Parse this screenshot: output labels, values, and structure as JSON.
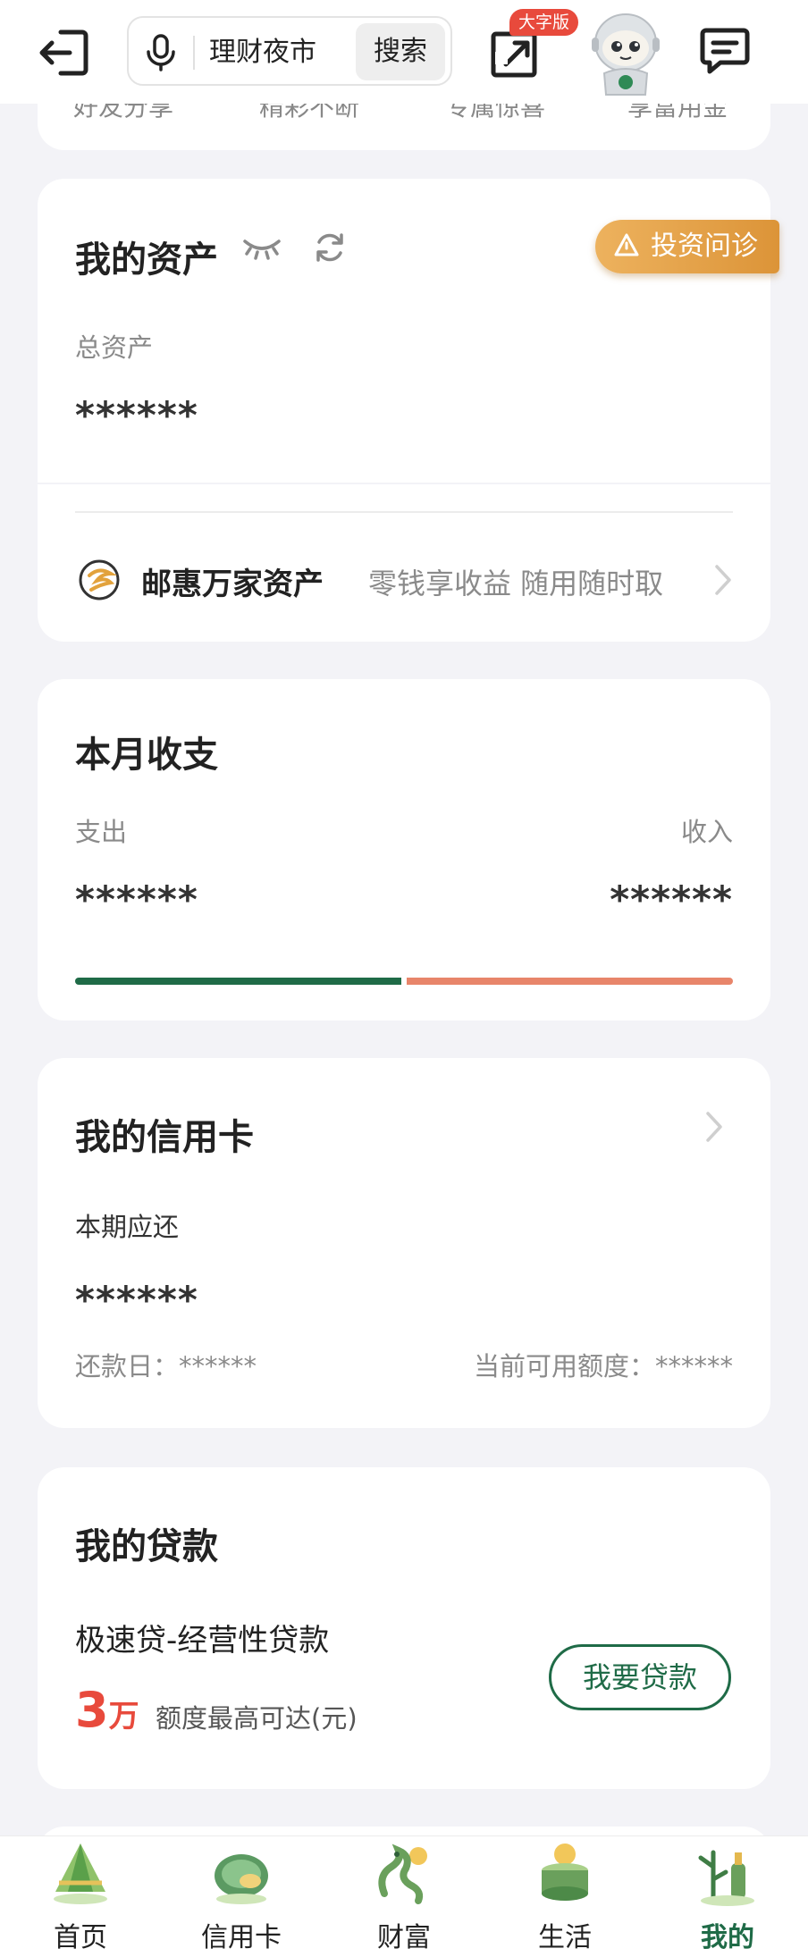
{
  "topbar": {
    "search_text": "理财夜市",
    "search_button": "搜索",
    "bigfont_badge": "大字版"
  },
  "peek_row": [
    "好友分享",
    "精彩不断",
    "专属惊喜",
    "享富用金"
  ],
  "assets": {
    "title": "我的资产",
    "invest_badge": "投资问诊",
    "total_label": "总资产",
    "total_value": "******",
    "product_name": "邮惠万家资产",
    "product_desc": "零钱享收益 随用随时取"
  },
  "monthly": {
    "title": "本月收支",
    "expense_label": "支出",
    "income_label": "收入",
    "expense_value": "******",
    "income_value": "******",
    "expense_share": 0.5
  },
  "credit": {
    "title": "我的信用卡",
    "due_label": "本期应还",
    "due_value": "******",
    "repay_day": "还款日：******",
    "available_limit": "当前可用额度：******"
  },
  "loan": {
    "title": "我的贷款",
    "product": "极速贷-经营性贷款",
    "amount_number": "3",
    "amount_unit": "万",
    "amount_desc": "额度最高可达(元)",
    "apply_button": "我要贷款"
  },
  "colors": {
    "brand_green": "#1f6b47",
    "income_orange": "#e8856a",
    "accent_red": "#e84a3c",
    "invest_gold": "#dc9438"
  },
  "nav": [
    {
      "label": "首页",
      "icon": "home-zongzi-icon"
    },
    {
      "label": "信用卡",
      "icon": "credit-card-mooncake-icon"
    },
    {
      "label": "财富",
      "icon": "wealth-dragon-icon"
    },
    {
      "label": "生活",
      "icon": "life-cake-icon"
    },
    {
      "label": "我的",
      "icon": "mine-bamboo-icon"
    }
  ]
}
